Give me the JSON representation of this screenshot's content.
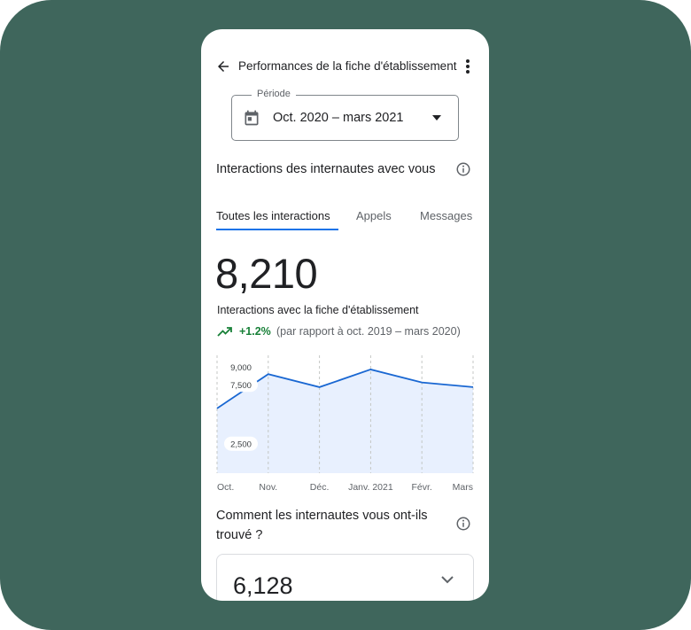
{
  "header": {
    "title": "Performances de la fiche d'établissement"
  },
  "period": {
    "label": "Période",
    "value": "Oct. 2020 – mars 2021"
  },
  "interactions_section": {
    "title": "Interactions des internautes avec vous"
  },
  "tabs": [
    {
      "label": "Toutes les interactions",
      "active": true
    },
    {
      "label": "Appels",
      "active": false
    },
    {
      "label": "Messages",
      "active": false
    }
  ],
  "metric": {
    "value": "8,210",
    "label": "Interactions avec la fiche d'établissement",
    "trend_value": "+1.2%",
    "trend_compare": "(par rapport à oct. 2019 – mars 2020)"
  },
  "chart_data": {
    "type": "area",
    "categories": [
      "Oct.",
      "Nov.",
      "Déc.",
      "Janv. 2021",
      "Févr.",
      "Mars"
    ],
    "tick_labels": [
      "Oct.",
      "Nov.",
      "Déc.",
      "Janv. 2021",
      "Févr.",
      "Mars"
    ],
    "x": [
      0,
      1,
      2,
      3,
      4,
      5
    ],
    "values": [
      5500,
      8400,
      7300,
      8800,
      7700,
      7300
    ],
    "y_tick_labels": [
      "9,000",
      "7,500",
      "2,500"
    ],
    "y_ticks": [
      9000,
      7500,
      2500
    ],
    "ylim": [
      0,
      10000
    ],
    "grid": "vertical-dashed",
    "colors": {
      "line": "#1967d2",
      "fill": "#e8f0fe"
    }
  },
  "discovery_section": {
    "title": "Comment les internautes vous ont-ils trouvé ?",
    "card_value": "6,128"
  },
  "colors": {
    "background": "#3f665c",
    "accent": "#1a73e8",
    "positive": "#188038"
  }
}
